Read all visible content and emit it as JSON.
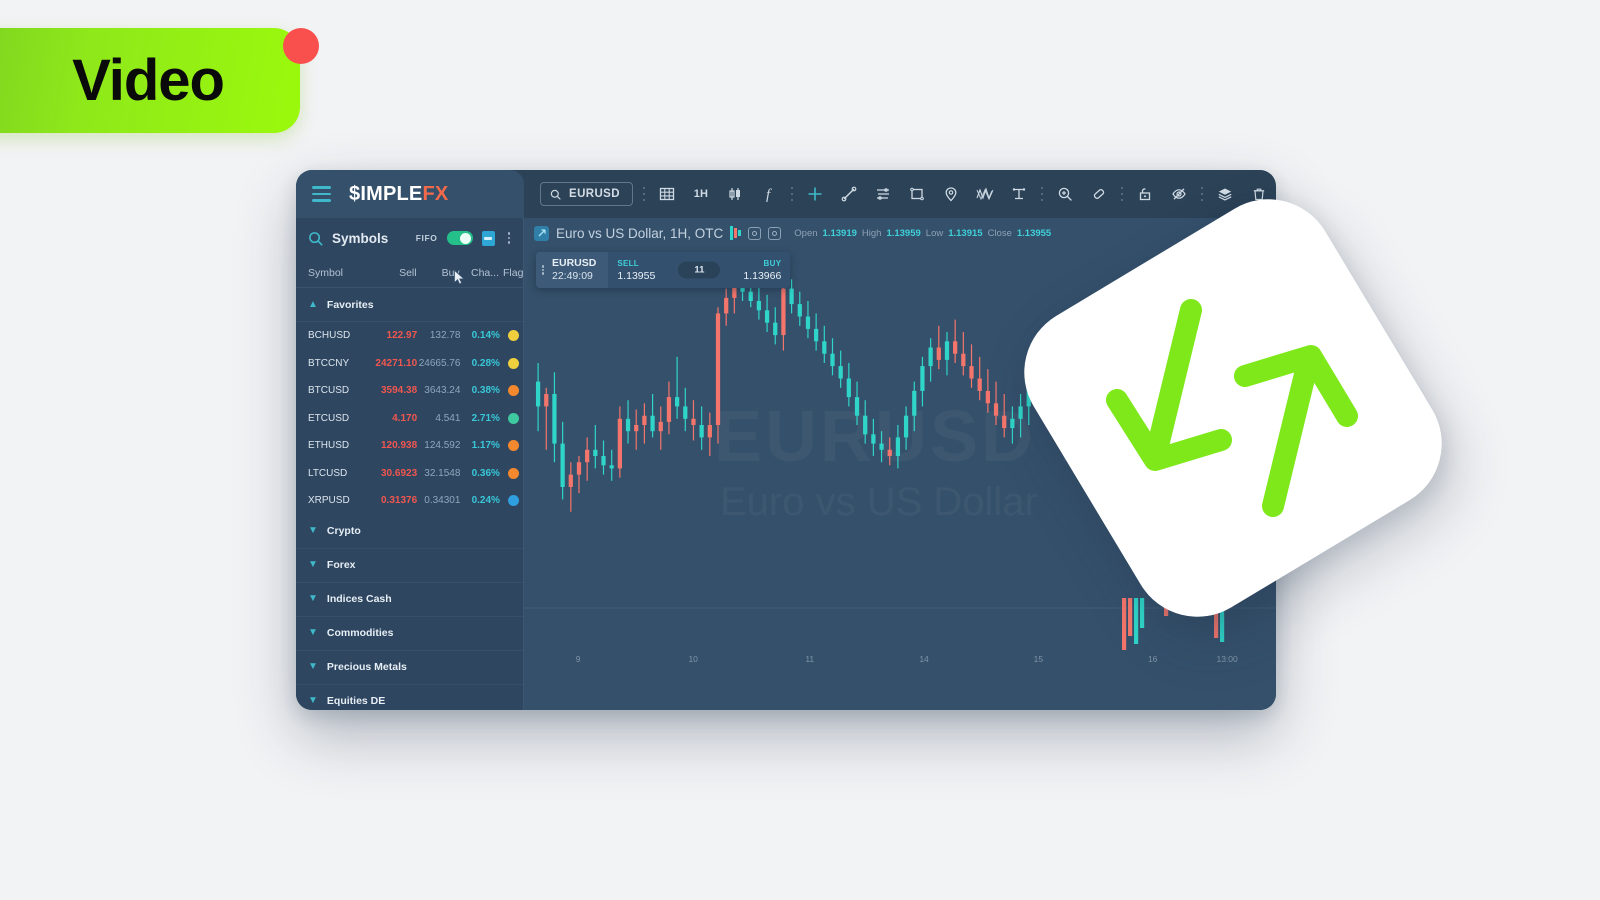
{
  "badge": {
    "label": "Video",
    "dot": "record-dot",
    "bg_from": "#7ed321",
    "bg_to": "#9bf90c"
  },
  "app": {
    "brand": {
      "part1": "$IMPLE",
      "part2": "FX"
    },
    "menu_icon": "hamburger-icon"
  },
  "toolbar": {
    "symbol_search": {
      "value": "EURUSD",
      "icon": "search-icon"
    },
    "buttons": [
      {
        "name": "grid-layout-icon",
        "label": ""
      },
      {
        "name": "timeframe-button",
        "label": "1H"
      },
      {
        "name": "candlestick-type-icon",
        "label": ""
      },
      {
        "name": "indicators-function-icon",
        "label": "ƒ"
      },
      {
        "name": "crosshair-icon",
        "label": ""
      },
      {
        "name": "trendline-icon",
        "label": ""
      },
      {
        "name": "fibonacci-icon",
        "label": ""
      },
      {
        "name": "rectangle-icon",
        "label": ""
      },
      {
        "name": "pin-marker-icon",
        "label": ""
      },
      {
        "name": "elliott-wave-icon",
        "label": ""
      },
      {
        "name": "measure-icon",
        "label": ""
      },
      {
        "name": "zoom-in-icon",
        "label": ""
      },
      {
        "name": "eraser-icon",
        "label": ""
      },
      {
        "name": "lock-icon",
        "label": ""
      },
      {
        "name": "hide-drawings-icon",
        "label": ""
      },
      {
        "name": "layers-icon",
        "label": ""
      },
      {
        "name": "trash-icon",
        "label": ""
      }
    ]
  },
  "sidebar": {
    "title": "Symbols",
    "search_icon": "search-icon",
    "fifo": {
      "label": "FIFO",
      "enabled": true
    },
    "calculator_icon": "calculator-icon",
    "more_icon": "kebab-menu-icon",
    "columns": [
      "Symbol",
      "Sell",
      "Buy",
      "Cha...",
      "Flag"
    ],
    "favorites_group": {
      "label": "Favorites",
      "expanded": true
    },
    "rows": [
      {
        "symbol": "BCHUSD",
        "sell": "122.97",
        "buy": "132.78",
        "change": "0.14%",
        "flag_color": "#f0cf3e"
      },
      {
        "symbol": "BTCCNY",
        "sell": "24271.10",
        "buy": "24665.76",
        "change": "0.28%",
        "flag_color": "#f0cf3e"
      },
      {
        "symbol": "BTCUSD",
        "sell": "3594.38",
        "buy": "3643.24",
        "change": "0.38%",
        "flag_color": "#f4882e"
      },
      {
        "symbol": "ETCUSD",
        "sell": "4.170",
        "buy": "4.541",
        "change": "2.71%",
        "flag_color": "#3ec9a0"
      },
      {
        "symbol": "ETHUSD",
        "sell": "120.938",
        "buy": "124.592",
        "change": "1.17%",
        "flag_color": "#f4882e"
      },
      {
        "symbol": "LTCUSD",
        "sell": "30.6923",
        "buy": "32.1548",
        "change": "0.36%",
        "flag_color": "#f4882e"
      },
      {
        "symbol": "XRPUSD",
        "sell": "0.31376",
        "buy": "0.34301",
        "change": "0.24%",
        "flag_color": "#2f9fe0"
      }
    ],
    "groups": [
      {
        "label": "Crypto",
        "expanded": false
      },
      {
        "label": "Forex",
        "expanded": false
      },
      {
        "label": "Indices Cash",
        "expanded": false
      },
      {
        "label": "Commodities",
        "expanded": false
      },
      {
        "label": "Precious Metals",
        "expanded": false
      },
      {
        "label": "Equities DE",
        "expanded": false
      }
    ]
  },
  "chart": {
    "title": "Euro vs US Dollar, 1H, OTC",
    "ohlc": {
      "open_label": "Open",
      "open": "1.13919",
      "high_label": "High",
      "high": "1.13959",
      "low_label": "Low",
      "low": "1.13915",
      "close_label": "Close",
      "close": "1.13955"
    },
    "watermark_line1": "EURUSD   1H",
    "watermark_line2": "Euro vs US Dollar",
    "trade_ticket": {
      "symbol": "EURUSD",
      "time": "22:49:09",
      "sell_label": "SELL",
      "sell_price": "1.13955",
      "spread": "11",
      "buy_label": "BUY",
      "buy_price": "1.13966"
    }
  },
  "chart_data": {
    "type": "candlestick",
    "title": "Euro vs US Dollar, 1H, OTC",
    "xlabel": "",
    "ylabel": "",
    "grid": false,
    "x_ticks": [
      "9",
      "10",
      "11",
      "14",
      "15",
      "16",
      "13:00"
    ],
    "x_tick_positions_pct": [
      7.2,
      22.5,
      38.0,
      53.2,
      68.4,
      83.6,
      93.5
    ],
    "up_color": "#2fd5c8",
    "down_color": "#f4756b",
    "candles": [
      {
        "o": 36,
        "h": 30,
        "l": 52,
        "c": 44,
        "d": 1
      },
      {
        "o": 44,
        "h": 38,
        "l": 58,
        "c": 40,
        "d": 0
      },
      {
        "o": 40,
        "h": 33,
        "l": 62,
        "c": 56,
        "d": 1
      },
      {
        "o": 56,
        "h": 49,
        "l": 74,
        "c": 70,
        "d": 1
      },
      {
        "o": 70,
        "h": 62,
        "l": 78,
        "c": 66,
        "d": 0
      },
      {
        "o": 66,
        "h": 60,
        "l": 72,
        "c": 62,
        "d": 0
      },
      {
        "o": 62,
        "h": 54,
        "l": 68,
        "c": 58,
        "d": 0
      },
      {
        "o": 58,
        "h": 50,
        "l": 64,
        "c": 60,
        "d": 1
      },
      {
        "o": 60,
        "h": 55,
        "l": 66,
        "c": 63,
        "d": 1
      },
      {
        "o": 63,
        "h": 58,
        "l": 68,
        "c": 64,
        "d": 1
      },
      {
        "o": 64,
        "h": 44,
        "l": 67,
        "c": 48,
        "d": 0
      },
      {
        "o": 48,
        "h": 42,
        "l": 56,
        "c": 52,
        "d": 1
      },
      {
        "o": 52,
        "h": 45,
        "l": 58,
        "c": 50,
        "d": 0
      },
      {
        "o": 50,
        "h": 43,
        "l": 56,
        "c": 47,
        "d": 0
      },
      {
        "o": 47,
        "h": 40,
        "l": 54,
        "c": 52,
        "d": 1
      },
      {
        "o": 52,
        "h": 44,
        "l": 58,
        "c": 49,
        "d": 0
      },
      {
        "o": 49,
        "h": 36,
        "l": 53,
        "c": 41,
        "d": 0
      },
      {
        "o": 41,
        "h": 28,
        "l": 48,
        "c": 44,
        "d": 1
      },
      {
        "o": 44,
        "h": 38,
        "l": 52,
        "c": 48,
        "d": 1
      },
      {
        "o": 48,
        "h": 42,
        "l": 55,
        "c": 50,
        "d": 0
      },
      {
        "o": 50,
        "h": 44,
        "l": 58,
        "c": 54,
        "d": 1
      },
      {
        "o": 54,
        "h": 46,
        "l": 60,
        "c": 50,
        "d": 0
      },
      {
        "o": 50,
        "h": 12,
        "l": 56,
        "c": 14,
        "d": 0
      },
      {
        "o": 14,
        "h": 6,
        "l": 18,
        "c": 9,
        "d": 0
      },
      {
        "o": 9,
        "h": 2,
        "l": 14,
        "c": 5,
        "d": 0
      },
      {
        "o": 5,
        "h": 1,
        "l": 10,
        "c": 7,
        "d": 1
      },
      {
        "o": 7,
        "h": 3,
        "l": 12,
        "c": 10,
        "d": 1
      },
      {
        "o": 10,
        "h": 5,
        "l": 16,
        "c": 13,
        "d": 1
      },
      {
        "o": 13,
        "h": 8,
        "l": 20,
        "c": 17,
        "d": 1
      },
      {
        "o": 17,
        "h": 12,
        "l": 24,
        "c": 21,
        "d": 1
      },
      {
        "o": 21,
        "h": 2,
        "l": 26,
        "c": 6,
        "d": 0
      },
      {
        "o": 6,
        "h": 3,
        "l": 14,
        "c": 11,
        "d": 1
      },
      {
        "o": 11,
        "h": 7,
        "l": 18,
        "c": 15,
        "d": 1
      },
      {
        "o": 15,
        "h": 10,
        "l": 22,
        "c": 19,
        "d": 1
      },
      {
        "o": 19,
        "h": 14,
        "l": 26,
        "c": 23,
        "d": 1
      },
      {
        "o": 23,
        "h": 18,
        "l": 30,
        "c": 27,
        "d": 1
      },
      {
        "o": 27,
        "h": 22,
        "l": 34,
        "c": 31,
        "d": 1
      },
      {
        "o": 31,
        "h": 26,
        "l": 38,
        "c": 35,
        "d": 1
      },
      {
        "o": 35,
        "h": 30,
        "l": 44,
        "c": 41,
        "d": 1
      },
      {
        "o": 41,
        "h": 36,
        "l": 50,
        "c": 47,
        "d": 1
      },
      {
        "o": 47,
        "h": 42,
        "l": 56,
        "c": 53,
        "d": 1
      },
      {
        "o": 53,
        "h": 48,
        "l": 60,
        "c": 56,
        "d": 1
      },
      {
        "o": 56,
        "h": 52,
        "l": 62,
        "c": 58,
        "d": 1
      },
      {
        "o": 58,
        "h": 54,
        "l": 63,
        "c": 60,
        "d": 0
      },
      {
        "o": 60,
        "h": 50,
        "l": 64,
        "c": 54,
        "d": 1
      },
      {
        "o": 54,
        "h": 44,
        "l": 58,
        "c": 47,
        "d": 1
      },
      {
        "o": 47,
        "h": 36,
        "l": 52,
        "c": 39,
        "d": 1
      },
      {
        "o": 39,
        "h": 28,
        "l": 44,
        "c": 31,
        "d": 1
      },
      {
        "o": 31,
        "h": 22,
        "l": 36,
        "c": 25,
        "d": 1
      },
      {
        "o": 25,
        "h": 18,
        "l": 32,
        "c": 29,
        "d": 0
      },
      {
        "o": 29,
        "h": 20,
        "l": 34,
        "c": 23,
        "d": 1
      },
      {
        "o": 23,
        "h": 16,
        "l": 30,
        "c": 27,
        "d": 0
      },
      {
        "o": 27,
        "h": 20,
        "l": 34,
        "c": 31,
        "d": 0
      },
      {
        "o": 31,
        "h": 24,
        "l": 38,
        "c": 35,
        "d": 0
      },
      {
        "o": 35,
        "h": 28,
        "l": 42,
        "c": 39,
        "d": 0
      },
      {
        "o": 39,
        "h": 32,
        "l": 46,
        "c": 43,
        "d": 0
      },
      {
        "o": 43,
        "h": 36,
        "l": 50,
        "c": 47,
        "d": 0
      },
      {
        "o": 47,
        "h": 40,
        "l": 54,
        "c": 51,
        "d": 0
      },
      {
        "o": 51,
        "h": 44,
        "l": 56,
        "c": 48,
        "d": 1
      },
      {
        "o": 48,
        "h": 40,
        "l": 54,
        "c": 44,
        "d": 1
      },
      {
        "o": 44,
        "h": 34,
        "l": 50,
        "c": 38,
        "d": 1
      },
      {
        "o": 38,
        "h": 30,
        "l": 44,
        "c": 34,
        "d": 1
      },
      {
        "o": 34,
        "h": 26,
        "l": 40,
        "c": 30,
        "d": 1
      },
      {
        "o": 30,
        "h": 22,
        "l": 36,
        "c": 26,
        "d": 1
      },
      {
        "o": 26,
        "h": 20,
        "l": 32,
        "c": 24,
        "d": 1
      },
      {
        "o": 24,
        "h": 18,
        "l": 30,
        "c": 22,
        "d": 1
      },
      {
        "o": 22,
        "h": 14,
        "l": 28,
        "c": 18,
        "d": 1
      },
      {
        "o": 18,
        "h": 12,
        "l": 24,
        "c": 20,
        "d": 0
      },
      {
        "o": 20,
        "h": 14,
        "l": 26,
        "c": 23,
        "d": 0
      },
      {
        "o": 23,
        "h": 18,
        "l": 30,
        "c": 27,
        "d": 0
      },
      {
        "o": 27,
        "h": 22,
        "l": 34,
        "c": 31,
        "d": 0
      },
      {
        "o": 31,
        "h": 26,
        "l": 38,
        "c": 35,
        "d": 0
      },
      {
        "o": 35,
        "h": 30,
        "l": 42,
        "c": 39,
        "d": 0
      },
      {
        "o": 39,
        "h": 34,
        "l": 46,
        "c": 43,
        "d": 0
      },
      {
        "o": 43,
        "h": 38,
        "l": 50,
        "c": 47,
        "d": 0
      },
      {
        "o": 47,
        "h": 42,
        "l": 54,
        "c": 50,
        "d": 0
      },
      {
        "o": 50,
        "h": 44,
        "l": 56,
        "c": 46,
        "d": 1
      },
      {
        "o": 46,
        "h": 38,
        "l": 52,
        "c": 41,
        "d": 1
      },
      {
        "o": 41,
        "h": 34,
        "l": 48,
        "c": 37,
        "d": 1
      },
      {
        "o": 37,
        "h": 30,
        "l": 44,
        "c": 34,
        "d": 1
      },
      {
        "o": 34,
        "h": 28,
        "l": 40,
        "c": 31,
        "d": 1
      },
      {
        "o": 31,
        "h": 24,
        "l": 37,
        "c": 28,
        "d": 1
      },
      {
        "o": 28,
        "h": 21,
        "l": 34,
        "c": 25,
        "d": 1
      },
      {
        "o": 25,
        "h": 18,
        "l": 31,
        "c": 22,
        "d": 1
      },
      {
        "o": 22,
        "h": 15,
        "l": 28,
        "c": 19,
        "d": 1
      },
      {
        "o": 19,
        "h": 13,
        "l": 25,
        "c": 21,
        "d": 0
      },
      {
        "o": 21,
        "h": 16,
        "l": 27,
        "c": 24,
        "d": 0
      },
      {
        "o": 24,
        "h": 18,
        "l": 30,
        "c": 27,
        "d": 0
      },
      {
        "o": 27,
        "h": 21,
        "l": 33,
        "c": 30,
        "d": 0
      },
      {
        "o": 30,
        "h": 24,
        "l": 36,
        "c": 33,
        "d": 0
      }
    ]
  },
  "swap_card": {
    "icon": "swap-arrows-icon",
    "arrow_color": "#7ee81a",
    "card_color": "#ffffff"
  }
}
